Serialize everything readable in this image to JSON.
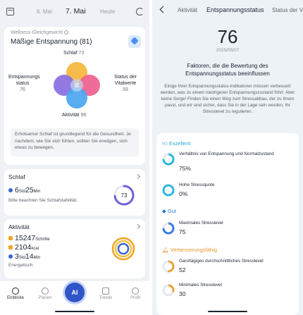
{
  "left": {
    "dates": {
      "prev": "6. Mai",
      "current": "7. Mai",
      "next": "Heute"
    },
    "wellness": {
      "label": "Wellness-Gleichgewicht",
      "title": "Mäßige Entspannung (81)",
      "schlaf_label": "Schlaf",
      "schlaf_value": "73",
      "entspannung_label": "Entspannungs status",
      "entspannung_value": "76",
      "vital_label": "Status der Vitalwerte",
      "vital_value": "93",
      "aktivitaet_label": "Aktivität",
      "aktivitaet_value": "98",
      "advice": "Erholsamer Schlaf ist grundlegend für die Gesundheit. Je nachdem, wie Sie sich fühlen, sollten Sie erwägen, sich etwas zu bewegen."
    },
    "schlaf": {
      "title": "Schlaf",
      "hours": "6",
      "hours_unit": "Std",
      "minutes": "25",
      "minutes_unit": "Min",
      "note": "Bitte beachten Sie Schlafstabilität.",
      "score": "73",
      "score_fraction": 0.73,
      "color": "#6f63d9"
    },
    "aktivitaet": {
      "title": "Aktivität",
      "steps": "15247",
      "steps_unit": "Schritte",
      "kcal": "2104",
      "kcal_unit": "kcal",
      "hours": "3",
      "hours_unit": "Std",
      "minutes": "14",
      "minutes_unit": "Min",
      "note": "Energetisch."
    },
    "nav": {
      "einblicke": "Einblicke",
      "planen": "Planen",
      "ai": "AI",
      "trends": "Trends",
      "profil": "Profil"
    }
  },
  "right": {
    "tabs": {
      "aktivitaet": "Aktivität",
      "entspannung": "Entspannungsstatus",
      "vital": "Status der Vi"
    },
    "score": "76",
    "date": "2025/05/07",
    "heading": "Faktoren, die die Bewertung des Entspannungsstatus beeinflussen",
    "description": "Einige Ihrer Entspannungsstatus-Indikatoren müssen verbessert werden, was zu einem niedrigeren Entspannungszustand führt. Aber keine Sorge! Finden Sie einen Weg zum Stressabbau, der zu Ihnen passt, und wir sind sicher, dass Sie in der Lage sein werden, Ihr Stresslevel zu regulieren.",
    "groups": {
      "exzellent": "Exzellent",
      "gut": "Gut",
      "verbesserung": "Verbesserungsfähig"
    },
    "items": [
      {
        "name": "Verhältnis von Entspannung und Normalzustand",
        "value": "75%",
        "fraction": 0.75,
        "color": "#2fb6e0"
      },
      {
        "name": "Hohe Stressquote",
        "value": "0%",
        "fraction": 0.0,
        "color": "#2fb6e0"
      },
      {
        "name": "Maximales Stresslevel",
        "value": "75",
        "fraction": 0.75,
        "color": "#3b7de0"
      },
      {
        "name": "Ganztägiges durchschnittliches Stresslevel",
        "value": "52",
        "fraction": 0.52,
        "color": "#eda13a"
      },
      {
        "name": "Minimales Stresslevel",
        "value": "30",
        "fraction": 0.3,
        "color": "#eda13a"
      }
    ]
  }
}
